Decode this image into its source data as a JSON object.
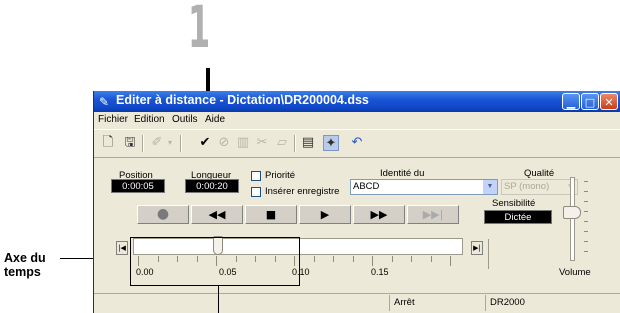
{
  "callout": {
    "number": "1"
  },
  "axis": {
    "label_line1": "Axe du",
    "label_line2": "temps"
  },
  "window": {
    "title": "Editer à distance - Dictation\\DR200004.dss",
    "title_icon": "pencil-icon",
    "controls": [
      "minimize-icon",
      "maximize-icon",
      "close-icon"
    ]
  },
  "menu": [
    {
      "label": "Fichier"
    },
    {
      "label": "Edition"
    },
    {
      "label": "Outils"
    },
    {
      "label": "Aide"
    }
  ],
  "toolbar": {
    "icons": [
      "new-file-icon",
      "save-icon",
      "edit-icon",
      "dropdown-arrow-icon",
      "checkmark-icon",
      "cancel-icon",
      "book-icon",
      "cut-icon",
      "insert-icon",
      "properties-icon",
      "connect-icon",
      "undo-icon"
    ]
  },
  "fields": {
    "position_label": "Position",
    "position_value": "0:00:05",
    "longueur_label": "Longueur",
    "longueur_value": "0:00:20",
    "priorite_label": "Priorité",
    "inserer_label": "Insérer enregistre",
    "identite_label": "Identité du",
    "identite_value": "ABCD",
    "qualite_label": "Qualité",
    "qualite_value": "SP (mono)",
    "sensibilite_label": "Sensibilité",
    "sensibilite_value": "Dictée",
    "volume_label": "Volume"
  },
  "transport": [
    "record-icon",
    "rewind-icon",
    "stop-icon",
    "play-icon",
    "fast-forward-icon",
    "skip-end-icon"
  ],
  "timeline": {
    "ticks": [
      "0.00",
      "0.05",
      "0.10",
      "0.15"
    ],
    "position_fraction": 0.25
  },
  "status": {
    "state": "Arrêt",
    "device": "DR2000"
  },
  "colors": {
    "titlebar": "#1a55d6",
    "window_bg": "#ece9d8"
  }
}
